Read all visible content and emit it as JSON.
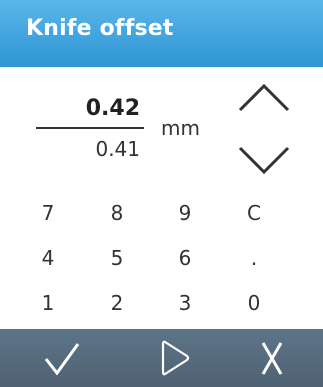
{
  "header": {
    "title": "Knife offset"
  },
  "value": {
    "new": "0.42",
    "old": "0.41",
    "unit": "mm"
  },
  "controls": {
    "increase_icon": "chevron-up-icon",
    "decrease_icon": "chevron-down-icon"
  },
  "keypad": {
    "rows": [
      [
        "7",
        "8",
        "9",
        "C"
      ],
      [
        "4",
        "5",
        "6",
        "."
      ],
      [
        "1",
        "2",
        "3",
        "0"
      ]
    ]
  },
  "footer": {
    "confirm_icon": "check-icon",
    "next_icon": "play-icon",
    "cancel_icon": "close-icon"
  },
  "colors": {
    "header_bg": "#3aa3df",
    "footer_bg": "#566b7e",
    "text": "#333333"
  }
}
